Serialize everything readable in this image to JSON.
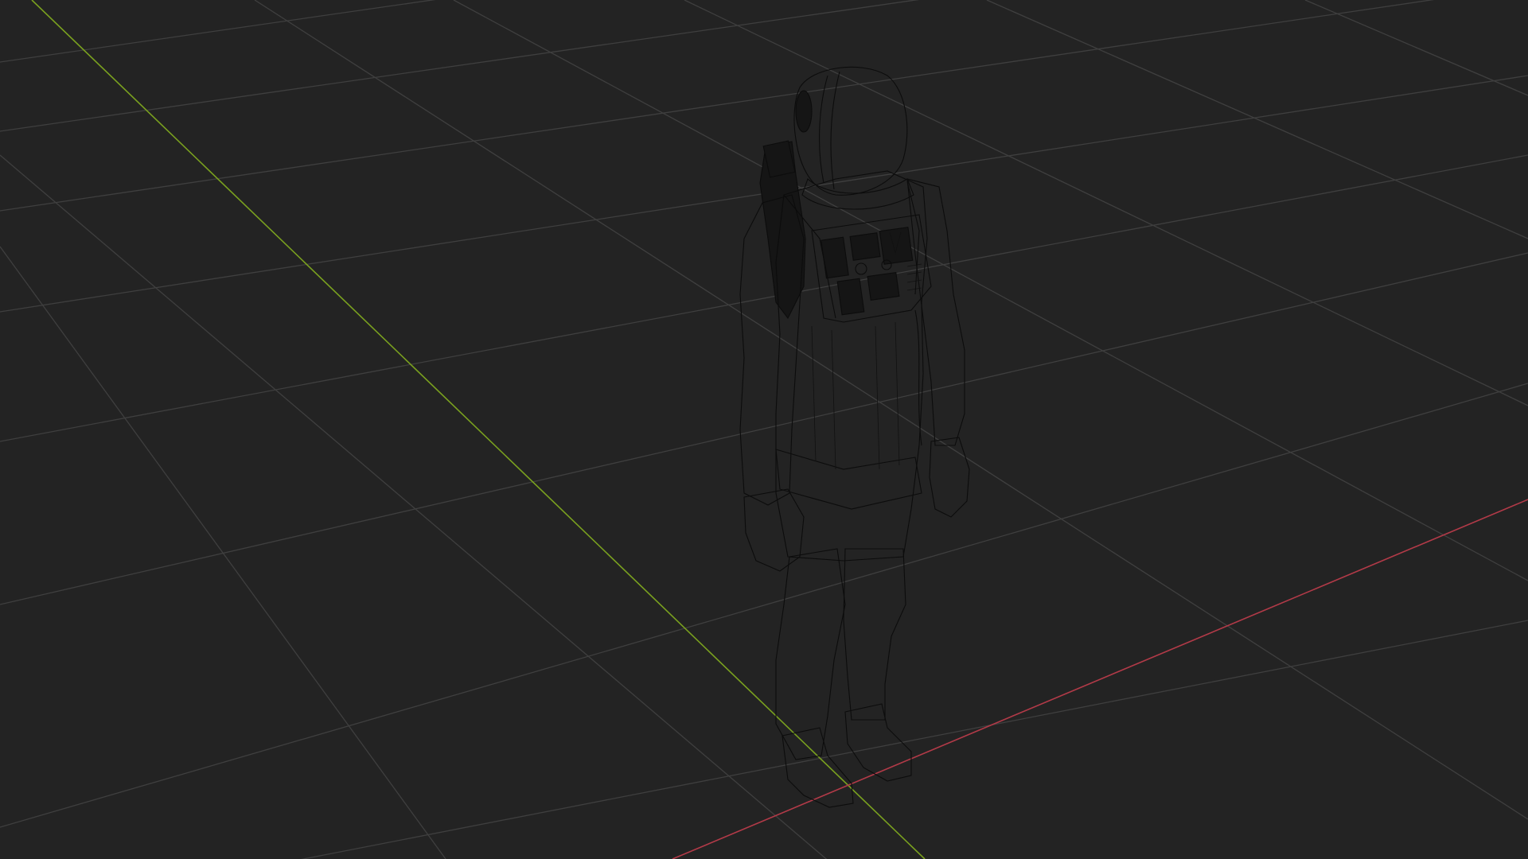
{
  "viewport": {
    "background_color": "#232323",
    "grid_color": "#3f3f3f",
    "axis_y_color": "#7aa11f",
    "axis_x_color": "#b23a48",
    "view_mode": "wireframe"
  },
  "model": {
    "subject": "astronaut",
    "mesh_fill_color": "#1f1f1f",
    "wire_color": "#0c0c0c"
  }
}
